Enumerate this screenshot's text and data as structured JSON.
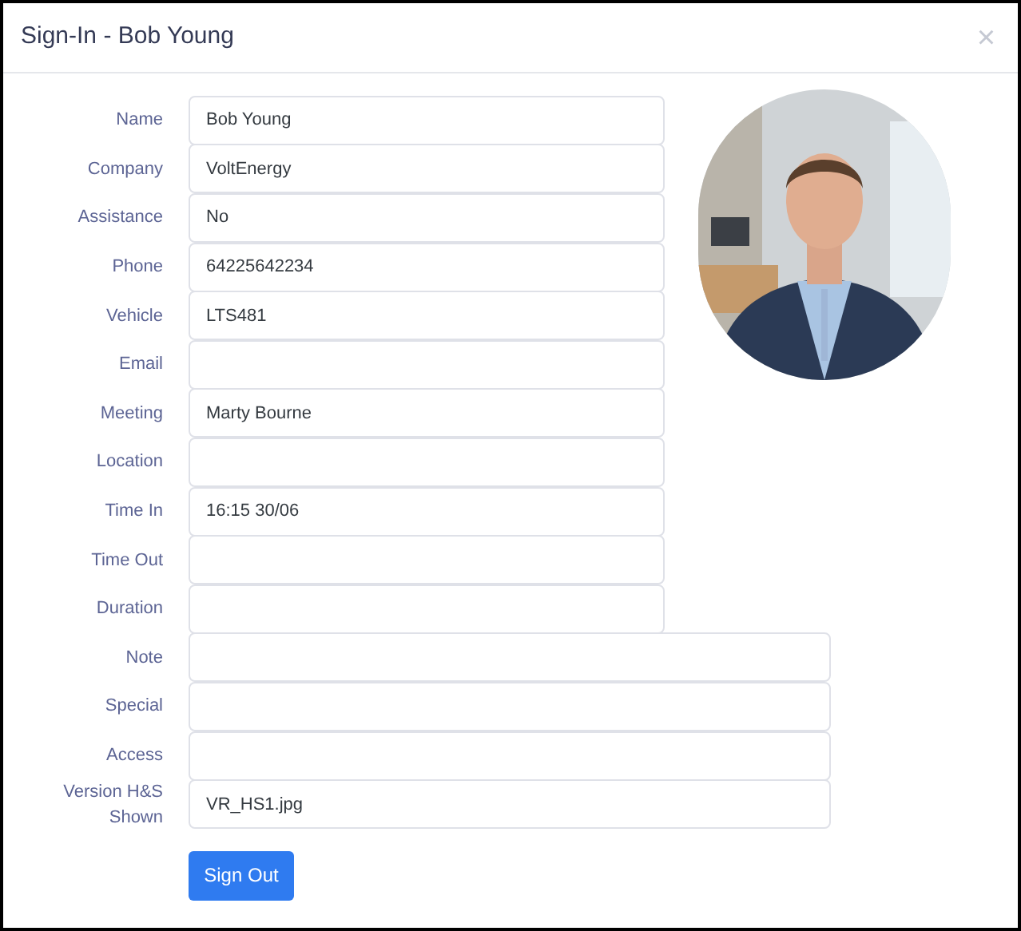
{
  "dialog": {
    "title": "Sign-In - Bob Young",
    "close": "×"
  },
  "fields": [
    {
      "label": "Name",
      "value": "Bob Young",
      "kind": "short"
    },
    {
      "label": "Company",
      "value": "VoltEnergy",
      "kind": "short"
    },
    {
      "label": "Assistance",
      "value": "No",
      "kind": "short"
    },
    {
      "label": "Phone",
      "value": "64225642234",
      "kind": "short"
    },
    {
      "label": "Vehicle",
      "value": "LTS481",
      "kind": "short"
    },
    {
      "label": "Email",
      "kind": "short"
    },
    {
      "label": "Meeting",
      "value": "Marty Bourne",
      "kind": "short"
    },
    {
      "label": "Location",
      "kind": "short"
    },
    {
      "label": "Time In",
      "value": "16:15 30/06",
      "kind": "short"
    },
    {
      "label": "Time Out",
      "kind": "short"
    },
    {
      "label": "Duration",
      "kind": "short"
    },
    {
      "label": "Note",
      "kind": "wide"
    },
    {
      "label": "Special",
      "kind": "wide"
    },
    {
      "label": "Access",
      "kind": "wide"
    },
    {
      "label": "Version H&S Shown",
      "value": "VR_HS1.jpg",
      "kind": "wide"
    }
  ],
  "button": "Sign Out"
}
